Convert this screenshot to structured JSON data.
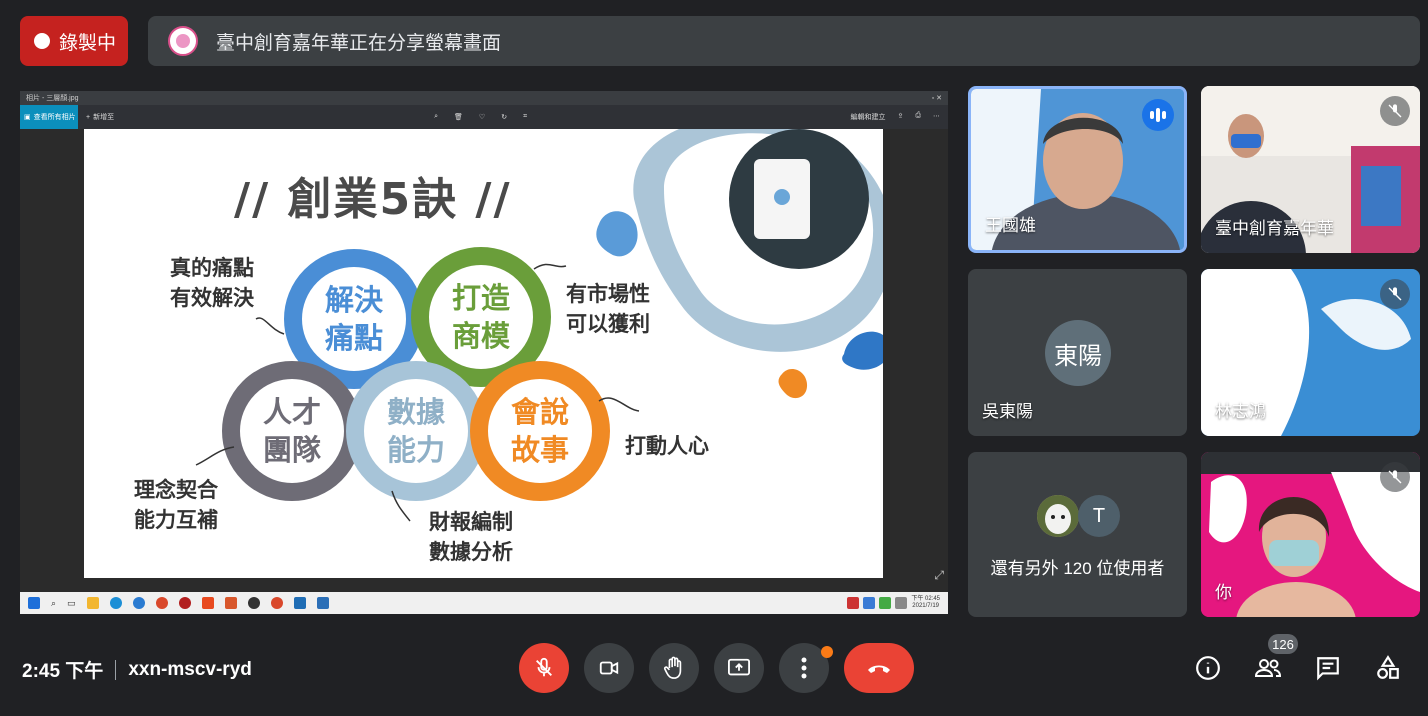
{
  "top": {
    "recording_label": "錄製中",
    "share_banner_text": "臺中創育嘉年華正在分享螢幕畫面"
  },
  "present": {
    "window_title": "相片 - 三層顏.jpg",
    "toolbar": {
      "collection_label": "查看所有相片",
      "add_label": "新增至",
      "edit_label": "編輯和建立"
    },
    "clock_time": "下午 02:45",
    "clock_date": "2021/7/19"
  },
  "slide": {
    "title": "// 創業5訣 //",
    "rings": {
      "blue": [
        "解決",
        "痛點"
      ],
      "green": [
        "打造",
        "商模"
      ],
      "gray": [
        "人才",
        "團隊"
      ],
      "light_blue": [
        "數據",
        "能力"
      ],
      "orange": [
        "會說",
        "故事"
      ]
    },
    "notes": {
      "pain": [
        "真的痛點",
        "有效解決"
      ],
      "market": [
        "有市場性",
        "可以獲利"
      ],
      "team": [
        "理念契合",
        "能力互補"
      ],
      "data": [
        "財報編制",
        "數據分析"
      ],
      "story": [
        "打動人心"
      ]
    }
  },
  "participants": {
    "p1": {
      "name": "王國雄"
    },
    "p2": {
      "name": "臺中創育嘉年華"
    },
    "p3": {
      "name": "吳東陽",
      "initials": "東陽"
    },
    "p4": {
      "name": "林志鴻"
    },
    "p5": {
      "others_label": "還有另外 120 位使用者",
      "avatar_initial": "T"
    },
    "p6": {
      "name": "你"
    }
  },
  "bottom": {
    "time": "2:45 下午",
    "meeting_code": "xxn-mscv-ryd",
    "participant_count": "126"
  },
  "colors": {
    "recording_red": "#c5221f",
    "hangup_red": "#ea4335",
    "speaking_blue": "#1a73e8",
    "background": "#202124"
  }
}
